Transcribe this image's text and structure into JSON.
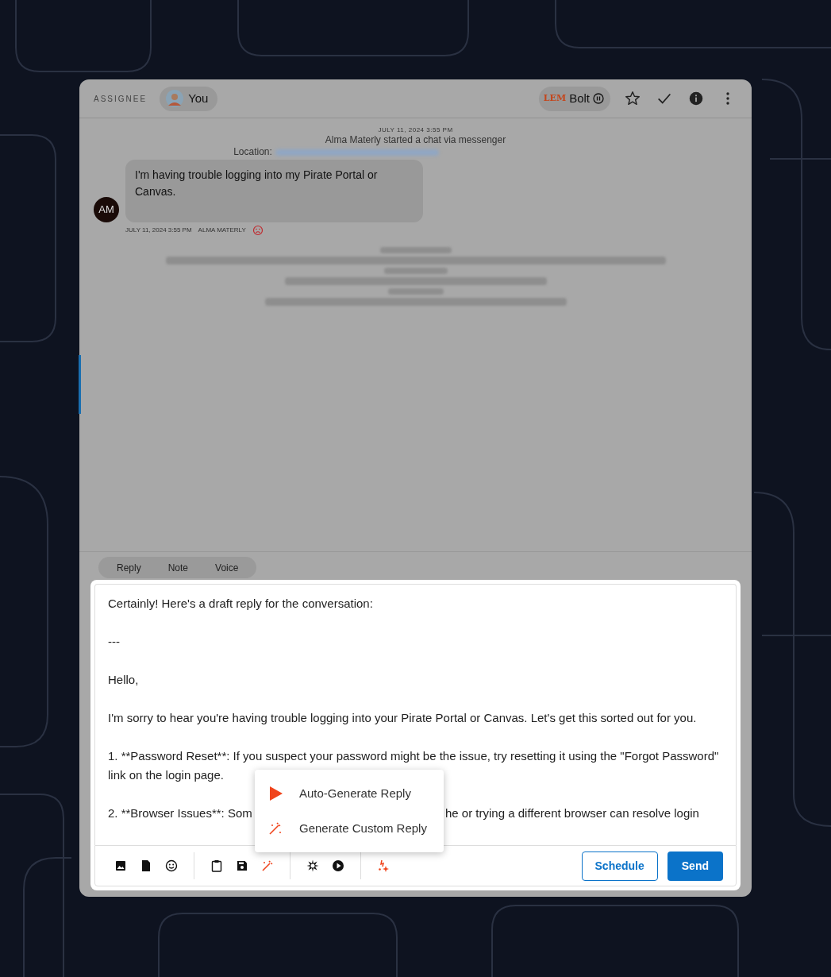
{
  "header": {
    "assignee_label": "ASSIGNEE",
    "assignee": "You",
    "bot": {
      "logo": "LEM",
      "name": "Bolt"
    }
  },
  "chat": {
    "start_time": "JULY 11, 2024 3:55 PM",
    "start_text": "Alma Materly started a chat via messenger",
    "location_label": "Location:",
    "message": {
      "initials": "AM",
      "text": "I'm having trouble logging into my Pirate Portal or Canvas.",
      "time": "JULY 11, 2024 3:55 PM",
      "author": "ALMA MATERLY"
    }
  },
  "tabs": [
    {
      "label": "Reply",
      "selected": false
    },
    {
      "label": "Note",
      "selected": false
    },
    {
      "label": "Voice",
      "selected": false
    }
  ],
  "editor": {
    "lines": [
      {
        "kind": "text",
        "text": "Certainly! Here's a draft reply for the conversation:"
      },
      {
        "kind": "text",
        "text": "---"
      },
      {
        "kind": "text",
        "text": "Hello,"
      },
      {
        "kind": "text",
        "text": "I'm sorry to hear you're having trouble logging into your Pirate Portal or Canvas. Let's get this sorted out for you."
      },
      {
        "kind": "text",
        "text": "1. **Password Reset**: If you suspect your password might be the issue, try resetting it using the \"Forgot Password\" link on the login page."
      },
      {
        "kind": "split",
        "text": "2. **Browser Issues**: Som",
        "rest": "he or trying a different browser can resolve login"
      }
    ]
  },
  "menu": [
    {
      "kind": "play",
      "label": "Auto-Generate Reply"
    },
    {
      "kind": "wand",
      "label": "Generate Custom Reply"
    }
  ],
  "buttons": {
    "schedule": "Schedule",
    "send": "Send"
  }
}
